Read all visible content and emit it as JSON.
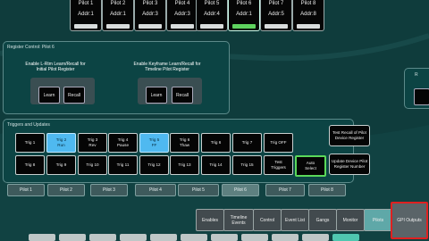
{
  "pilots": [
    {
      "label": "Pilot 1",
      "addr": "Addr:1",
      "selected": false
    },
    {
      "label": "Pilot 2",
      "addr": "Addr:1",
      "selected": false
    },
    {
      "label": "Pilot 3",
      "addr": "Addr:3",
      "selected": false
    },
    {
      "label": "Pilot 4",
      "addr": "Addr:3",
      "selected": false
    },
    {
      "label": "Pilot 5",
      "addr": "Addr:4",
      "selected": false
    },
    {
      "label": "Pilot 6",
      "addr": "Addr:1",
      "selected": true
    },
    {
      "label": "Pilot 7",
      "addr": "Addr:5",
      "selected": false
    },
    {
      "label": "Pilot 8",
      "addr": "Addr:8",
      "selected": false
    }
  ],
  "pilot_control": {
    "title": "Register Control: Pilot 6",
    "groups": [
      {
        "caption": "Enable L-Rtm Learn/Recall for Initial Pilot Register",
        "learn": "Learn",
        "recall": "Recall"
      },
      {
        "caption": "Enable Keyframe Learn/Recall for Timeline Pilot Register",
        "learn": "Learn",
        "recall": "Recall"
      }
    ],
    "right_label": "R"
  },
  "triggers": {
    "title": "Triggers and Updates",
    "row1": [
      {
        "label": "Trig 1",
        "sub": "",
        "style": "normal"
      },
      {
        "label": "Trig 2",
        "sub": "Run",
        "style": "blue"
      },
      {
        "label": "Trig 3",
        "sub": "Rev",
        "style": "normal"
      },
      {
        "label": "Trig 4",
        "sub": "Pause",
        "style": "normal"
      },
      {
        "label": "Trig 5",
        "sub": "FF",
        "style": "blue"
      },
      {
        "label": "Trig 6",
        "sub": "Thaw",
        "style": "normal"
      },
      {
        "label": "Trig 6",
        "sub": "",
        "style": "normal"
      },
      {
        "label": "Trig 7",
        "sub": "",
        "style": "normal"
      },
      {
        "label": "Trig OFF",
        "sub": "",
        "style": "normal"
      }
    ],
    "row2": [
      {
        "label": "Trig 8",
        "sub": "",
        "style": "normal"
      },
      {
        "label": "Trig 9",
        "sub": "",
        "style": "normal"
      },
      {
        "label": "Trig 10",
        "sub": "",
        "style": "normal"
      },
      {
        "label": "Trig 11",
        "sub": "",
        "style": "normal"
      },
      {
        "label": "Trig 12",
        "sub": "",
        "style": "normal"
      },
      {
        "label": "Trig 13",
        "sub": "",
        "style": "normal"
      },
      {
        "label": "Trig 14",
        "sub": "",
        "style": "normal"
      },
      {
        "label": "Trig 15",
        "sub": "",
        "style": "normal"
      },
      {
        "label": "Test",
        "sub": "Triggers",
        "style": "normal"
      },
      {
        "label": "Auto",
        "sub": "Select",
        "style": "green"
      }
    ],
    "test_recall": "Test Recall of Pilot Device Register",
    "update_device": "Update Device Pilot Register Number"
  },
  "pilot_tabs": [
    "Pilot 1",
    "Pilot 2",
    "Pilot 3",
    "Pilot 4",
    "Pilot 5",
    "Pilot 6",
    "Pilot 7",
    "Pilot 8"
  ],
  "active_pilot_tab": 5,
  "bottom_tabs": [
    {
      "label": "Enables",
      "style": "normal"
    },
    {
      "label": "Timeline Events",
      "style": "normal"
    },
    {
      "label": "Control",
      "style": "normal"
    },
    {
      "label": "Event List",
      "style": "normal"
    },
    {
      "label": "Gangs",
      "style": "normal"
    },
    {
      "label": "Monitor",
      "style": "normal"
    },
    {
      "label": "Pilots",
      "style": "teal"
    },
    {
      "label": "GPI Outputs",
      "style": "highlight"
    }
  ],
  "colors": {
    "background": "#0f3c3c",
    "panel": "#0c4444",
    "active_green": "#5ed25e",
    "trigger_blue": "#4fb9f0",
    "highlight_red": "#e02020"
  }
}
